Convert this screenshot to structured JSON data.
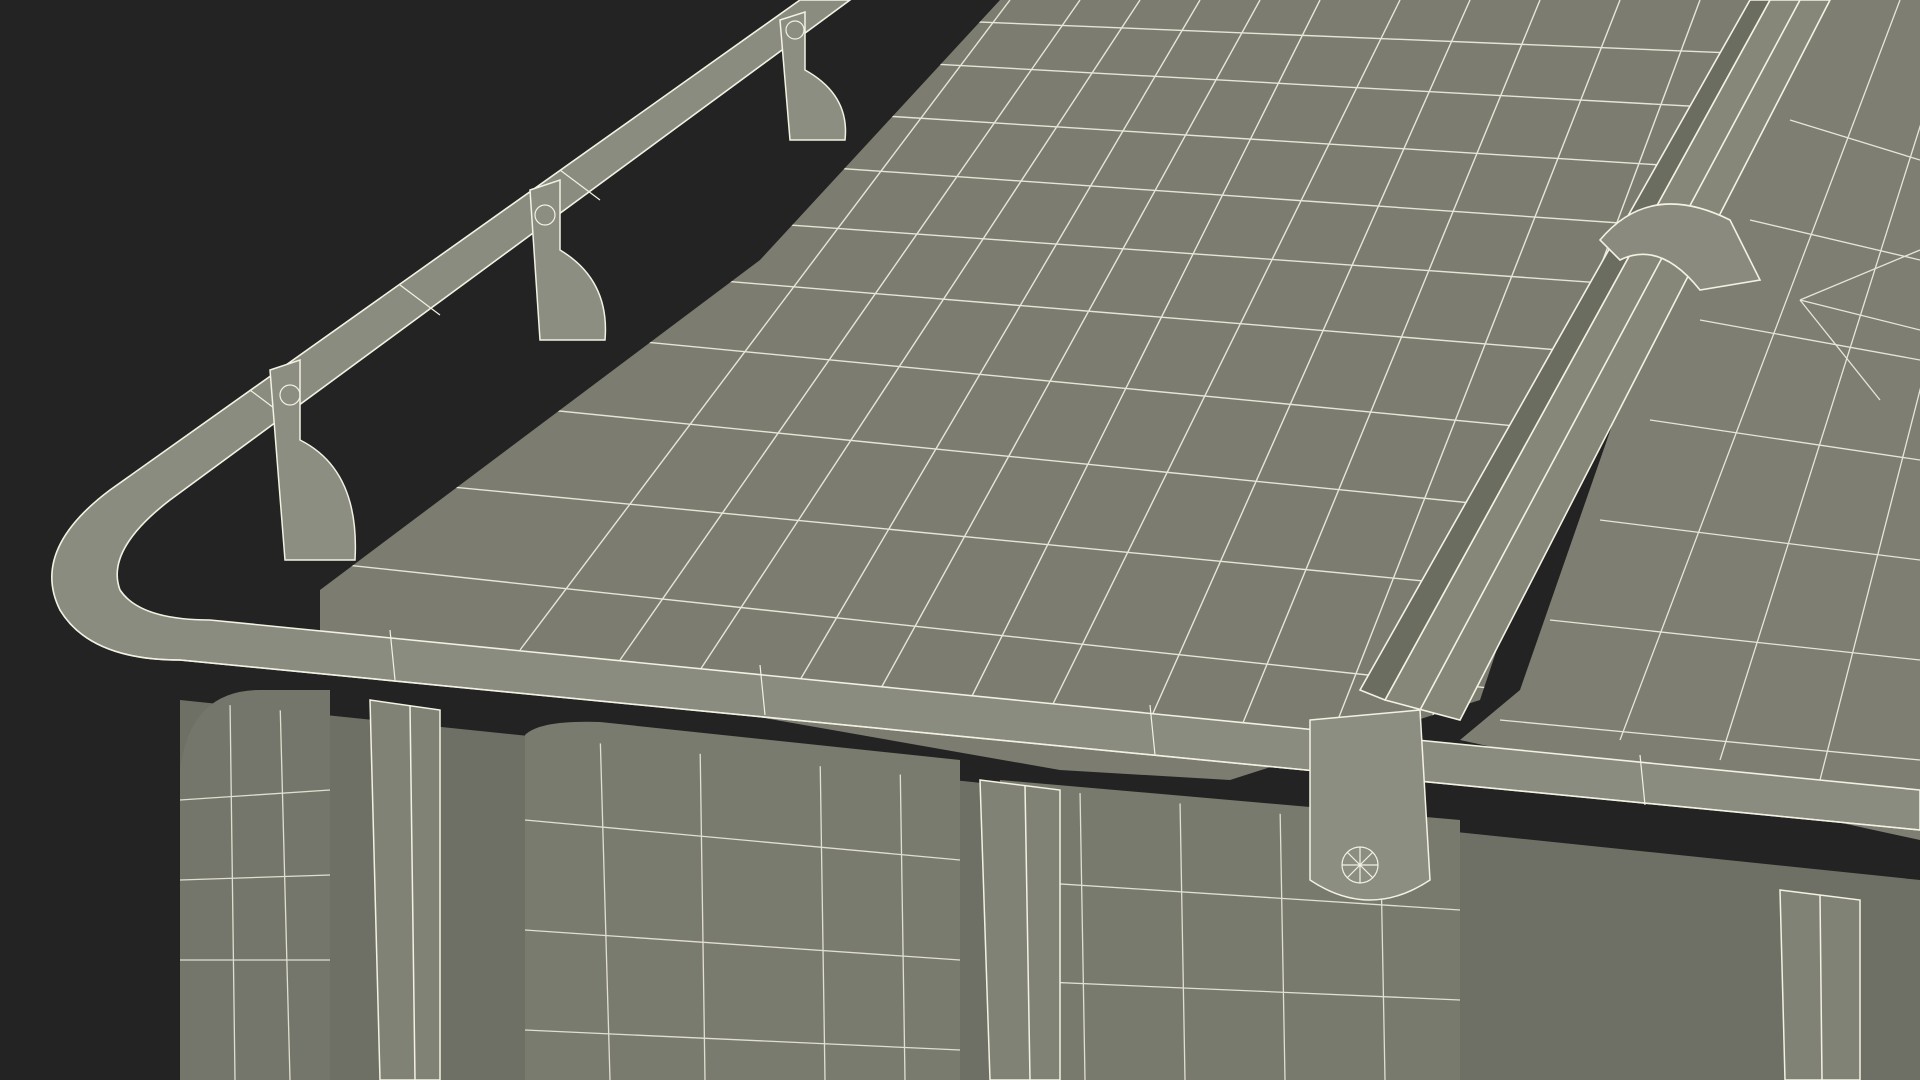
{
  "scene": {
    "subject": "wireframe-3d-render",
    "colors": {
      "background": "#232323",
      "surface": "#7c7d70",
      "surface_dark": "#686a5e",
      "surface_light": "#8a8b7e",
      "shadow": "#55574d",
      "wire": "#f3f1e2"
    }
  }
}
